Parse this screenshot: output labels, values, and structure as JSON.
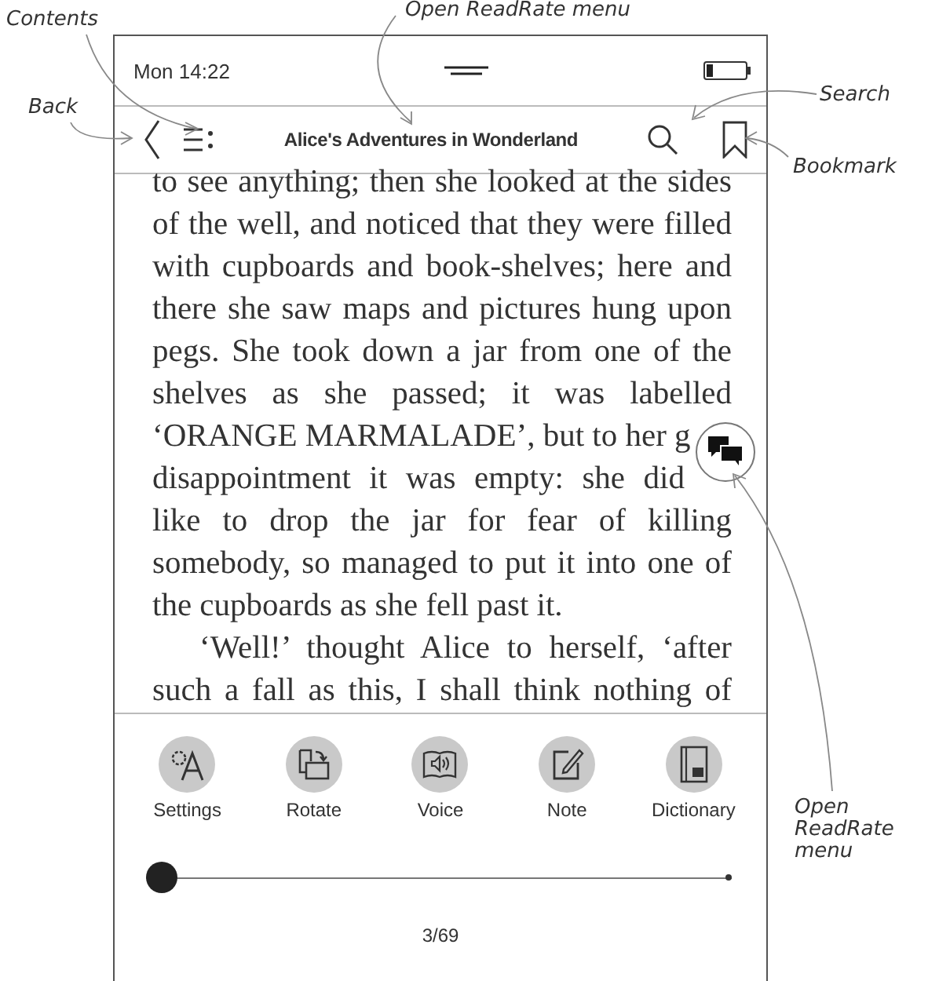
{
  "callouts": [
    {
      "kind": "contents",
      "text": "Contents"
    },
    {
      "kind": "top",
      "text": "Open ReadRate menu"
    },
    {
      "kind": "back",
      "text": "Back"
    },
    {
      "kind": "search",
      "text": "Search"
    },
    {
      "kind": "bookmark",
      "text": "Bookmark"
    },
    {
      "kind": "readrate",
      "text": "Open ReadRate menu"
    }
  ],
  "status_bar": {
    "time": "Mon 14:22"
  },
  "toolbar": {
    "title": "Alice's Adventures in Wonderland"
  },
  "page": {
    "paragraphs": [
      {
        "lines": [
          {
            "text": "to see anything; then she looked at the sides",
            "covered": false
          },
          {
            "text": "of the well, and noticed that they were filled",
            "covered": false
          },
          {
            "text": "with cupboards and book-shelves; here and",
            "covered": false
          },
          {
            "text": "there she saw maps and pictures hung upon",
            "covered": false
          },
          {
            "text": "pegs. She took down a jar from one of the",
            "covered": false
          },
          {
            "text": "shelves as she passed; it was labelled",
            "covered": false
          },
          {
            "text": "‘ORANGE MARMALADE’, but to her g",
            "covered": true
          },
          {
            "text": "disappointment it was empty: she did",
            "covered": true
          },
          {
            "text": "like to drop the jar for fear of killing",
            "covered": false
          },
          {
            "text": "somebody, so managed to put it into one of",
            "covered": false
          },
          {
            "text": "the cupboards as she fell past it.",
            "covered": false
          }
        ]
      },
      {
        "lines": [
          {
            "text": "‘Well!’ thought Alice to herself, ‘after",
            "covered": false
          },
          {
            "text": "such a fall as this, I shall think nothing of",
            "covered": false
          }
        ]
      }
    ]
  },
  "actions": [
    {
      "kind": "settings",
      "label": "Settings"
    },
    {
      "kind": "rotate",
      "label": "Rotate"
    },
    {
      "kind": "voice",
      "label": "Voice"
    },
    {
      "kind": "note",
      "label": "Note"
    },
    {
      "kind": "dictionary",
      "label": "Dictionary"
    }
  ],
  "progress": {
    "level": 0,
    "page": "3/69"
  }
}
